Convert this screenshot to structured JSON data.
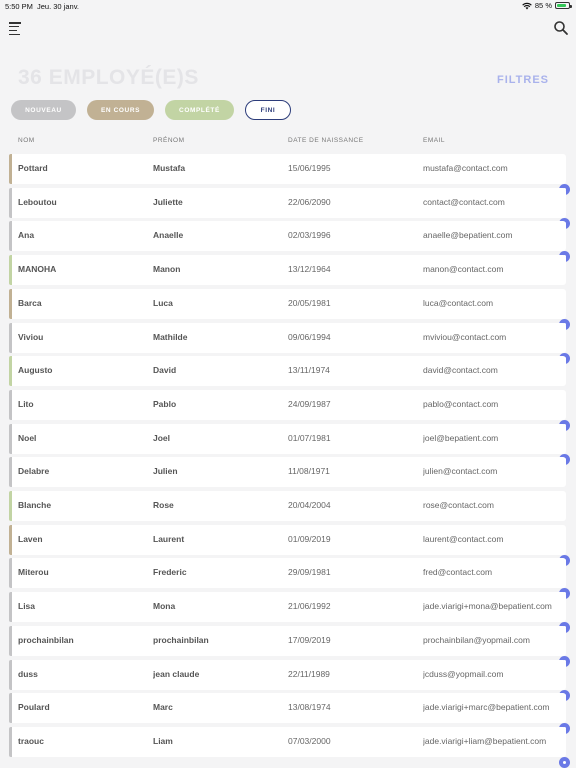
{
  "status": {
    "time": "5:50 PM",
    "date": "Jeu. 30 janv.",
    "battery": "85 %"
  },
  "title": "36 EMPLOYÉ(E)S",
  "filters_label": "FILTRES",
  "status_pills": {
    "nouveau": "NOUVEAU",
    "en_cours": "EN COURS",
    "complete": "COMPLÉTÉ",
    "fini": "FINI"
  },
  "columns": {
    "nom": "NOM",
    "prenom": "PRÉNOM",
    "date": "DATE DE NAISSANCE",
    "email": "EMAIL"
  },
  "colors": {
    "nouveau": "#c4c4c6",
    "en_cours": "#c1b194",
    "complete": "#c2d4a4",
    "fini": "#2c3c7a",
    "accent": "#6a79e6"
  },
  "rows": [
    {
      "nom": "Pottard",
      "prenom": "Mustafa",
      "date": "15/06/1995",
      "email": "mustafa@contact.com",
      "status": "en_cours",
      "dot": true
    },
    {
      "nom": "Leboutou",
      "prenom": "Juliette",
      "date": "22/06/2090",
      "email": "contact@contact.com",
      "status": "nouveau",
      "dot": true
    },
    {
      "nom": "Ana",
      "prenom": "Anaelle",
      "date": "02/03/1996",
      "email": "anaelle@bepatient.com",
      "status": "nouveau",
      "dot": true
    },
    {
      "nom": "MANOHA",
      "prenom": "Manon",
      "date": "13/12/1964",
      "email": "manon@contact.com",
      "status": "complete",
      "dot": false
    },
    {
      "nom": "Barca",
      "prenom": "Luca",
      "date": "20/05/1981",
      "email": "luca@contact.com",
      "status": "en_cours",
      "dot": true
    },
    {
      "nom": "Viviou",
      "prenom": "Mathilde",
      "date": "09/06/1994",
      "email": "mviviou@contact.com",
      "status": "nouveau",
      "dot": true
    },
    {
      "nom": "Augusto",
      "prenom": "David",
      "date": "13/11/1974",
      "email": "david@contact.com",
      "status": "complete",
      "dot": false
    },
    {
      "nom": "Lito",
      "prenom": "Pablo",
      "date": "24/09/1987",
      "email": "pablo@contact.com",
      "status": "nouveau",
      "dot": true
    },
    {
      "nom": "Noel",
      "prenom": "Joel",
      "date": "01/07/1981",
      "email": "joel@bepatient.com",
      "status": "nouveau",
      "dot": true
    },
    {
      "nom": "Delabre",
      "prenom": "Julien",
      "date": "11/08/1971",
      "email": "julien@contact.com",
      "status": "nouveau",
      "dot": false
    },
    {
      "nom": "Blanche",
      "prenom": "Rose",
      "date": "20/04/2004",
      "email": "rose@contact.com",
      "status": "complete",
      "dot": false
    },
    {
      "nom": "Laven",
      "prenom": "Laurent",
      "date": "01/09/2019",
      "email": "laurent@contact.com",
      "status": "en_cours",
      "dot": true
    },
    {
      "nom": "Miterou",
      "prenom": "Frederic",
      "date": "29/09/1981",
      "email": "fred@contact.com",
      "status": "nouveau",
      "dot": true
    },
    {
      "nom": "Lisa",
      "prenom": "Mona",
      "date": "21/06/1992",
      "email": "jade.viarigi+mona@bepatient.com",
      "status": "nouveau",
      "dot": true
    },
    {
      "nom": "prochainbilan",
      "prenom": "prochainbilan",
      "date": "17/09/2019",
      "email": "prochainbilan@yopmail.com",
      "status": "nouveau",
      "dot": true
    },
    {
      "nom": "duss",
      "prenom": "jean claude",
      "date": "22/11/1989",
      "email": "jcduss@yopmail.com",
      "status": "nouveau",
      "dot": true
    },
    {
      "nom": "Poulard",
      "prenom": "Marc",
      "date": "13/08/1974",
      "email": "jade.viarigi+marc@bepatient.com",
      "status": "nouveau",
      "dot": true
    },
    {
      "nom": "traouc",
      "prenom": "Liam",
      "date": "07/03/2000",
      "email": "jade.viarigi+liam@bepatient.com",
      "status": "nouveau",
      "dot": true
    }
  ]
}
